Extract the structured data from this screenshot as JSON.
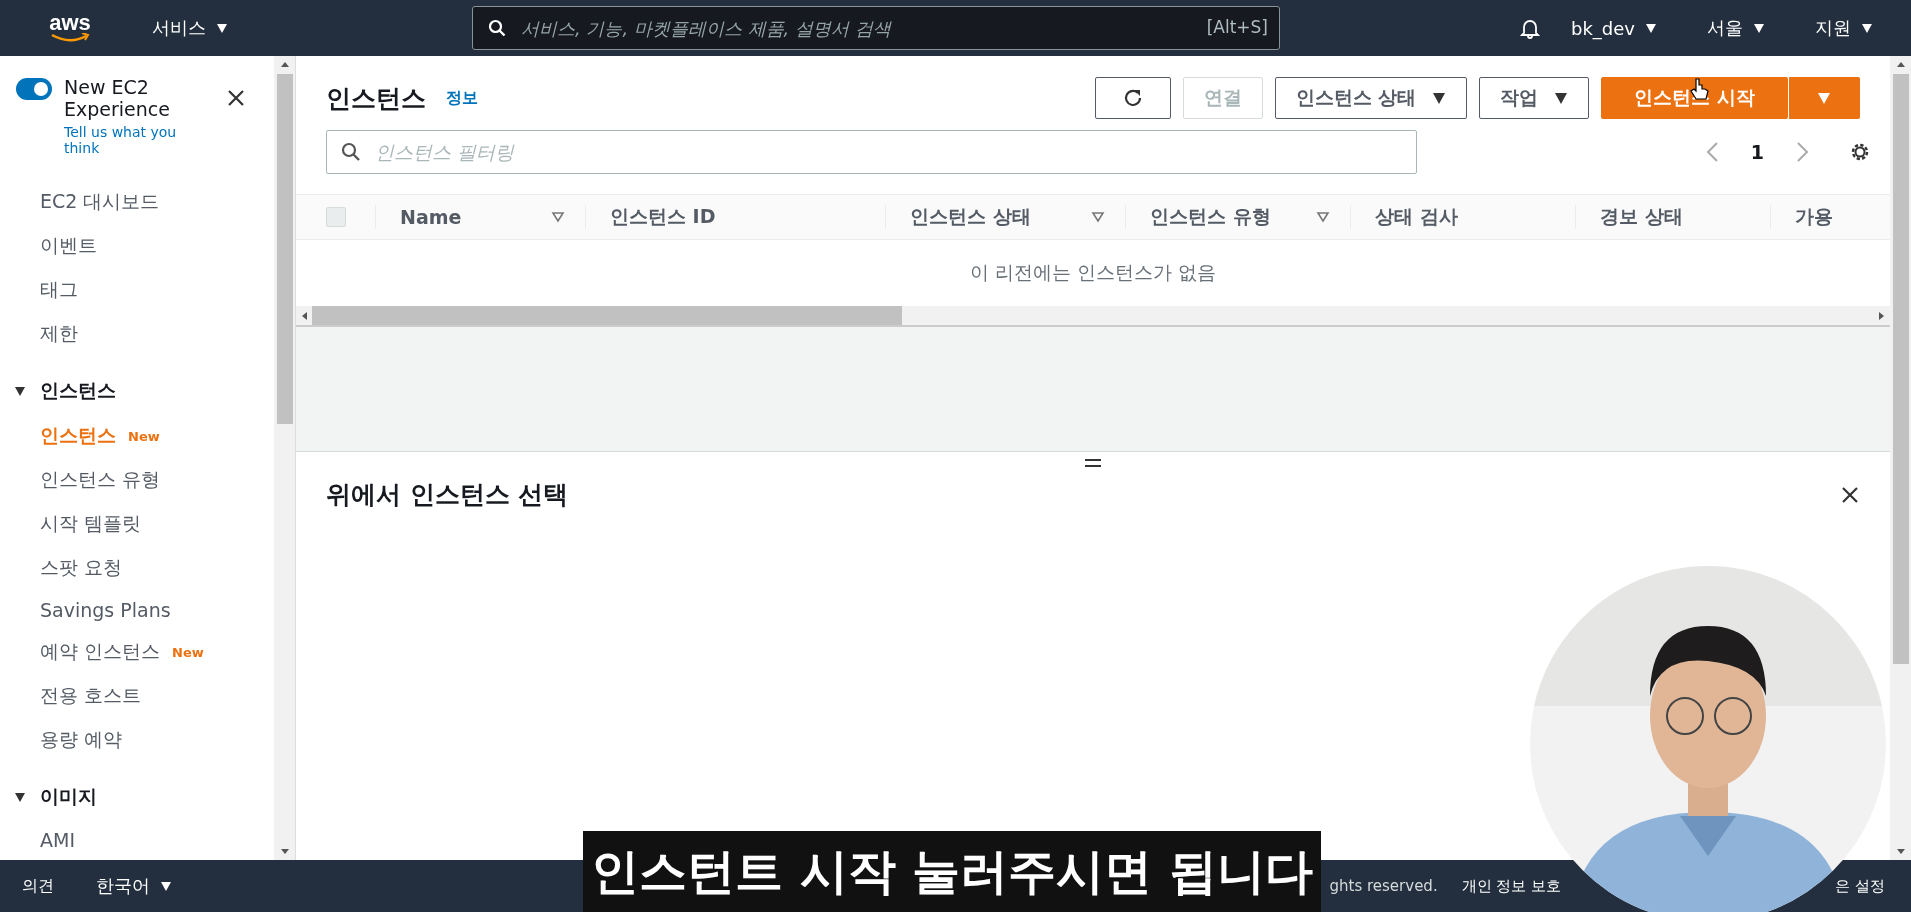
{
  "header": {
    "logo": "aws",
    "services": "서비스",
    "search_placeholder": "서비스, 기능, 마켓플레이스 제품, 설명서 검색",
    "search_shortcut": "[Alt+S]",
    "account": "bk_dev",
    "region": "서울",
    "support": "지원"
  },
  "sidebar": {
    "toggle": {
      "label": "New EC2 Experience",
      "on": true
    },
    "feedback_link": "Tell us what you think",
    "items": [
      {
        "kind": "link",
        "label": "EC2 대시보드",
        "selected": false
      },
      {
        "kind": "link",
        "label": "이벤트",
        "selected": false
      },
      {
        "kind": "link",
        "label": "태그",
        "selected": false
      },
      {
        "kind": "link",
        "label": "제한",
        "selected": false
      },
      {
        "kind": "section",
        "label": "인스턴스",
        "expanded": true,
        "children": [
          {
            "label": "인스턴스",
            "selected": true,
            "badge": "New"
          },
          {
            "label": "인스턴스 유형",
            "selected": false
          },
          {
            "label": "시작 템플릿",
            "selected": false
          },
          {
            "label": "스팟 요청",
            "selected": false
          },
          {
            "label": "Savings Plans",
            "selected": false
          },
          {
            "label": "예약 인스턴스",
            "selected": false,
            "badge": "New"
          },
          {
            "label": "전용 호스트",
            "selected": false
          },
          {
            "label": "용량 예약",
            "selected": false
          }
        ]
      },
      {
        "kind": "section",
        "label": "이미지",
        "expanded": true,
        "children": [
          {
            "label": "AMI",
            "selected": false
          }
        ]
      }
    ]
  },
  "main": {
    "title": "인스턴스",
    "info": "정보",
    "actions": [
      {
        "kind": "refresh",
        "disabled": false
      },
      {
        "kind": "plain",
        "label": "연결",
        "disabled": true
      },
      {
        "kind": "dropdown",
        "label": "인스턴스 상태",
        "disabled": false
      },
      {
        "kind": "dropdown",
        "label": "작업",
        "disabled": false
      },
      {
        "kind": "primary",
        "label": "인스턴스 시작"
      },
      {
        "kind": "split",
        "disabled": false
      }
    ],
    "filter_placeholder": "인스턴스 필터링",
    "page": "1",
    "table": {
      "select_all": {
        "checked": false
      },
      "columns": [
        {
          "label": "Name",
          "sortable": true
        },
        {
          "label": "인스턴스 ID",
          "sortable": false
        },
        {
          "label": "인스턴스 상태",
          "sortable": true
        },
        {
          "label": "인스턴스 유형",
          "sortable": true
        },
        {
          "label": "상태 검사",
          "sortable": false
        },
        {
          "label": "경보 상태",
          "sortable": false
        },
        {
          "label": "가용",
          "sortable": false
        }
      ],
      "empty_message": "이 리전에는 인스턴스가 없음"
    },
    "detail": {
      "title": "위에서 인스턴스 선택"
    }
  },
  "footer": {
    "feedback": "의견",
    "language": "한국어",
    "copyright": "ghts reserved.",
    "privacy": "개인 정보 보호",
    "settings": "은 설정"
  },
  "video_overlay": {
    "kind": "picture",
    "subtitle": "인스턴트 시작 눌러주시면 됩니다"
  }
}
